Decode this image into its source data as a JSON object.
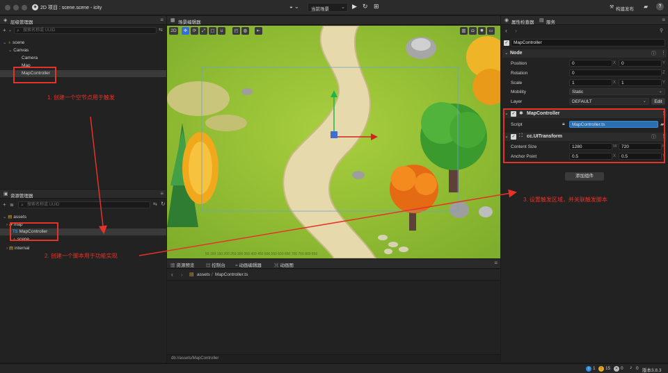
{
  "window": {
    "title": "2D 项目 : scene.scene - icity",
    "scene_select": "当前场景",
    "publish_label": "构建发布"
  },
  "hierarchy": {
    "title": "层级管理器",
    "search_placeholder": "搜索名称或 UUID",
    "items": [
      {
        "label": "scene"
      },
      {
        "label": "Canvas"
      },
      {
        "label": "Camera"
      },
      {
        "label": "Map"
      },
      {
        "label": "MapController"
      }
    ]
  },
  "assets": {
    "title": "资源管理器",
    "search_placeholder": "搜索名称或 UUID",
    "items": [
      {
        "label": "assets"
      },
      {
        "label": "map"
      },
      {
        "label": "MapController",
        "icon": "TS"
      },
      {
        "label": "scene"
      },
      {
        "label": "internal"
      }
    ]
  },
  "scene_editor": {
    "title": "场景编辑器",
    "mode_2d": "2D",
    "ruler_labels": "50  100  150  200  250  300  350  400  450  500  550  600  650  700  750  800  850"
  },
  "bottom_panel": {
    "tabs": [
      {
        "label": "资源预览"
      },
      {
        "label": "控制台"
      },
      {
        "label": "动画编辑器"
      },
      {
        "label": "动画图"
      }
    ],
    "breadcrumb_root": "assets",
    "breadcrumb_leaf": "MapController.ts",
    "footer_path": "db://assets/MapController"
  },
  "inspector": {
    "tabs": [
      {
        "label": "属性检查器"
      },
      {
        "label": "服务"
      }
    ],
    "node_name": "MapController",
    "node_section": "Node",
    "position": {
      "label": "Position",
      "x": "0",
      "y": "0",
      "x_axis": "X",
      "y_axis": "Y"
    },
    "rotation": {
      "label": "Rotation",
      "z": "0",
      "z_axis": "Z"
    },
    "scale": {
      "label": "Scale",
      "x": "1",
      "y": "1",
      "x_axis": "X",
      "y_axis": "Y"
    },
    "mobility": {
      "label": "Mobility",
      "value": "Static"
    },
    "layer": {
      "label": "Layer",
      "value": "DEFAULT",
      "edit": "Edit"
    },
    "component_script": {
      "name": "MapController",
      "script_label": "Script",
      "script_value": "MapController.ts"
    },
    "component_transform": {
      "name": "cc.UITransform",
      "content_size_label": "Content Size",
      "width": "1280",
      "w_axis": "W",
      "height": "720",
      "h_axis": "H",
      "anchor_label": "Anchor Point",
      "anchor_x": "0.5",
      "ax_axis": "X",
      "anchor_y": "0.5",
      "ay_axis": "Y"
    },
    "add_component": "添加组件"
  },
  "annotations": {
    "step1": "1. 创建一个空节点用于触发",
    "step2": "2. 创建一个脚本用于功能实现",
    "step3": "3. 设置触发区域，并关联触发脚本",
    "color": "#e5332a"
  },
  "status": {
    "info_count": "1",
    "warn_count": "15",
    "error_count": "0",
    "notice_count": "0",
    "version": "版本3.8.3"
  }
}
